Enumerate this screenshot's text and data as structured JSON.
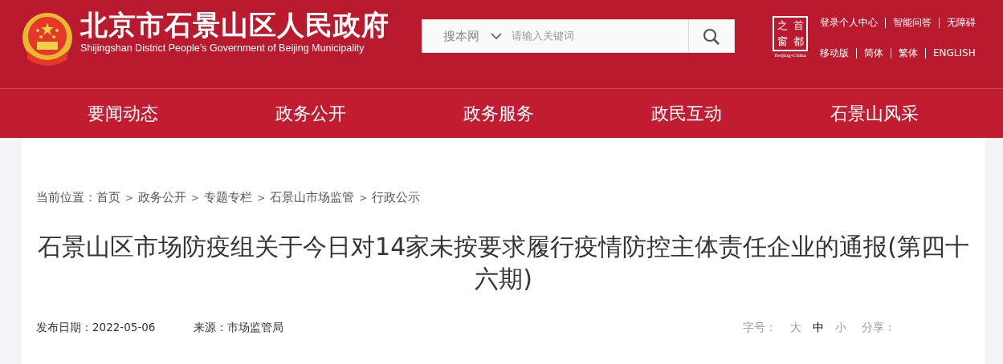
{
  "header": {
    "site_title": "北京市石景山区人民政府",
    "site_subtitle": "Shijingshan District People’s Government of Beijing Municipality",
    "search": {
      "scope": "搜本网",
      "placeholder": "请输入关键词"
    },
    "badge": {
      "chars": [
        "之",
        "首",
        "窗",
        "都"
      ],
      "caption": "Beijing-China"
    },
    "links_row_1": [
      "登录个人中心",
      "智能问答",
      "无障碍"
    ],
    "links_row_2": [
      "移动版",
      "简体",
      "繁体",
      "ENGLISH"
    ]
  },
  "nav": [
    "要闻动态",
    "政务公开",
    "政务服务",
    "政民互动",
    "石景山风采"
  ],
  "breadcrumb": {
    "label": "当前位置：",
    "items": [
      "首页",
      "政务公开",
      "专题专栏",
      "石景山市场监管",
      "行政公示"
    ],
    "separator": ">"
  },
  "article": {
    "title": "石景山区市场防疫组关于今日对14家未按要求履行疫情防控主体责任企业的通报(第四十六期)",
    "date": "发布日期：2022-05-06",
    "source": "来源：市场监管局",
    "font_size_label": "字号：",
    "font_sizes": [
      {
        "label": "大",
        "selected": false
      },
      {
        "label": "中",
        "selected": true
      },
      {
        "label": "小",
        "selected": false
      }
    ],
    "share_label": "分享："
  }
}
